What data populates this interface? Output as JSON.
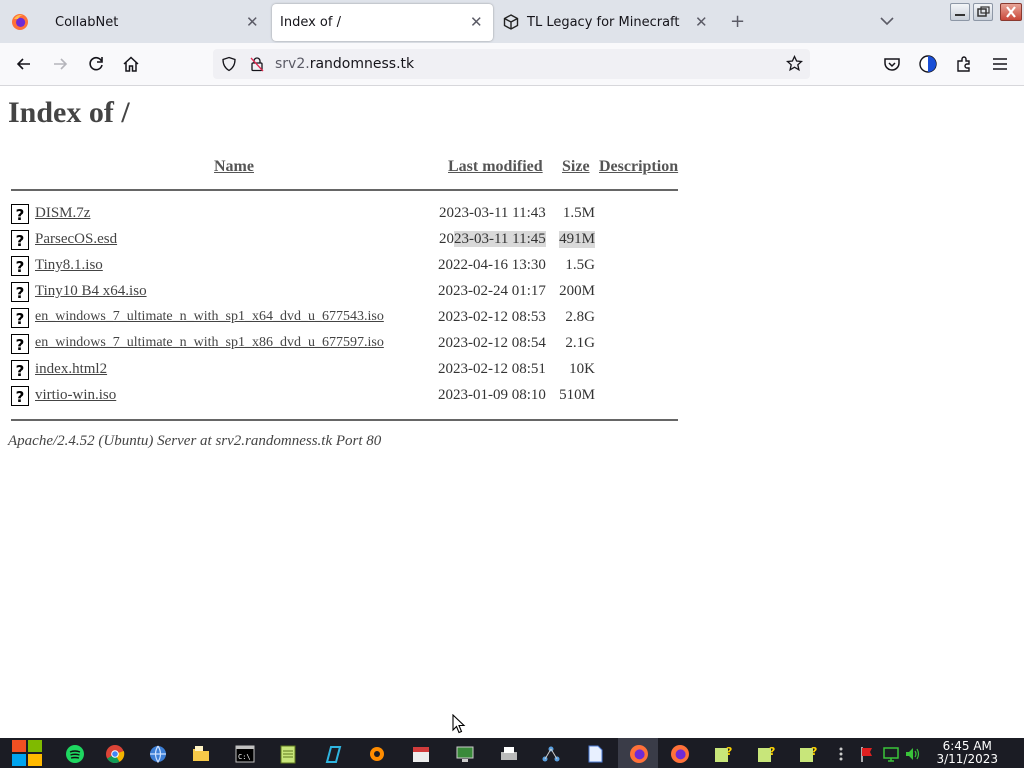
{
  "browser": {
    "tabs": [
      {
        "label": "CollabNet",
        "active": false
      },
      {
        "label": "Index of /",
        "active": true
      },
      {
        "label": "TL Legacy for Minecraft",
        "active": false
      }
    ],
    "url": {
      "domain_prefix": "srv2.",
      "domain_main": "randomness.tk"
    },
    "icons": [
      "firefox-icon",
      "back-icon",
      "forward-icon",
      "reload-icon",
      "home-icon",
      "shield-icon",
      "lock-icon",
      "bookmark-star-icon",
      "pocket-icon",
      "extension-icon",
      "puzzle-icon",
      "menu-icon"
    ]
  },
  "listing": {
    "title": "Index of /",
    "columns": {
      "name": "Name",
      "modified": "Last modified",
      "size": "Size",
      "description": "Description"
    },
    "files": [
      {
        "name": "DISM.7z",
        "modified": "2023-03-11 11:43",
        "size": "1.5M"
      },
      {
        "name": "ParsecOS.esd",
        "modified_pre": "20",
        "modified": "23-03-11 11:45",
        "size": "491M"
      },
      {
        "name": "Tiny8.1.iso",
        "modified": "2022-04-16 13:30",
        "size": "1.5G"
      },
      {
        "name": "Tiny10 B4 x64.iso",
        "modified": "2023-02-24 01:17",
        "size": "200M"
      },
      {
        "name": "en_windows_7_ultimate_n_with_sp1_x64_dvd_u_677543.iso",
        "modified": "2023-02-12 08:53",
        "size": "2.8G"
      },
      {
        "name": "en_windows_7_ultimate_n_with_sp1_x86_dvd_u_677597.iso",
        "modified": "2023-02-12 08:54",
        "size": "2.1G"
      },
      {
        "name": "index.html2",
        "modified": "2023-02-12 08:51",
        "size": "10K"
      },
      {
        "name": "virtio-win.iso",
        "modified": "2023-01-09 08:10",
        "size": "510M"
      }
    ],
    "footer": "Apache/2.4.52 (Ubuntu) Server at srv2.randomness.tk Port 80"
  },
  "taskbar": {
    "time": "6:45 AM",
    "date": "3/11/2023",
    "colors": {
      "background": "#1b1c24",
      "accent": "#0078d7"
    }
  }
}
